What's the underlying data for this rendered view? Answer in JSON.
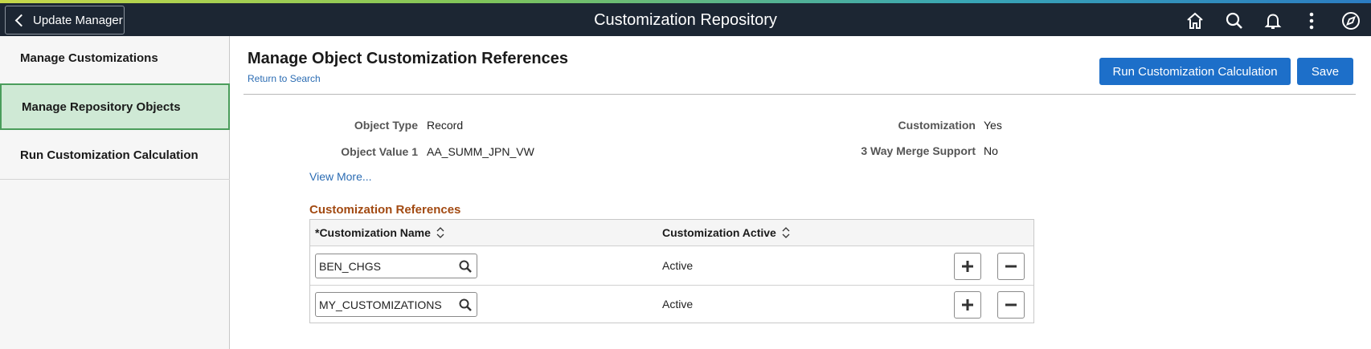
{
  "header": {
    "back_label": "Update Manager",
    "title": "Customization Repository",
    "icons": [
      "home-icon",
      "search-icon",
      "bell-icon",
      "more-icon",
      "navbar-icon"
    ]
  },
  "sidebar": {
    "items": [
      {
        "label": "Manage Customizations",
        "selected": false
      },
      {
        "label": "Manage Repository Objects",
        "selected": true
      },
      {
        "label": "Run Customization Calculation",
        "selected": false
      }
    ]
  },
  "main": {
    "title": "Manage Object Customization References",
    "return_link": "Return to Search",
    "run_button": "Run Customization Calculation",
    "save_button": "Save",
    "fields": {
      "object_type_label": "Object Type",
      "object_type_value": "Record",
      "object_value1_label": "Object Value 1",
      "object_value1_value": "AA_SUMM_JPN_VW",
      "customization_label": "Customization",
      "customization_value": "Yes",
      "merge_label": "3 Way Merge Support",
      "merge_value": "No"
    },
    "view_more": "View More...",
    "section_title": "Customization References",
    "grid": {
      "col_name": "*Customization Name",
      "col_active": "Customization Active",
      "rows": [
        {
          "name": "BEN_CHGS",
          "active": "Active"
        },
        {
          "name": "MY_CUSTOMIZATIONS",
          "active": "Active"
        }
      ]
    }
  },
  "colors": {
    "topbar": "#1c2633",
    "primary_button": "#1d6fc9",
    "selected_side_bg": "#cfe9d5",
    "selected_side_border": "#4a9d5b",
    "section_title": "#a24a12",
    "link": "#2b6cb3"
  }
}
